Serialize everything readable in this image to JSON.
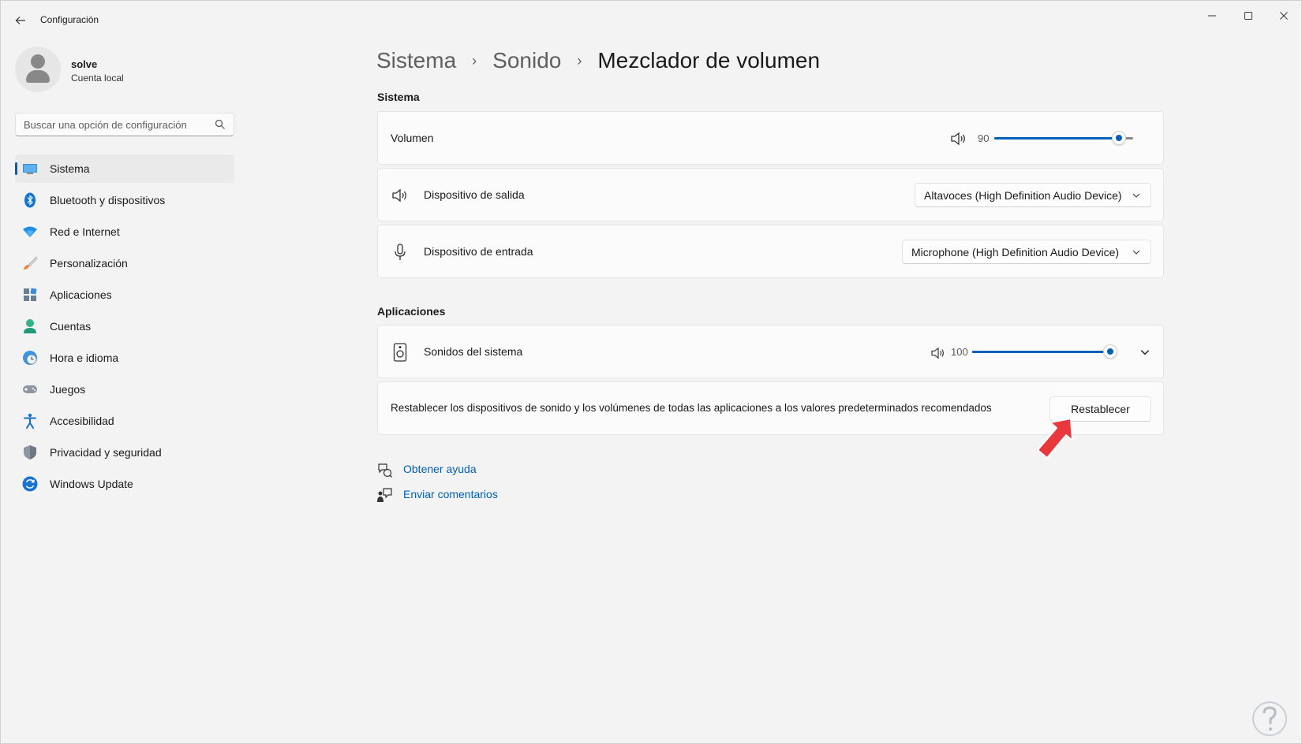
{
  "window": {
    "title": "Configuración",
    "controls": {
      "minimize": "minimize-icon",
      "maximize": "maximize-icon",
      "close": "close-icon"
    }
  },
  "profile": {
    "name": "solve",
    "account_type": "Cuenta local"
  },
  "search": {
    "placeholder": "Buscar una opción de configuración"
  },
  "sidebar": {
    "items": [
      {
        "label": "Sistema",
        "icon": "system-icon",
        "active": true
      },
      {
        "label": "Bluetooth y dispositivos",
        "icon": "bluetooth-icon"
      },
      {
        "label": "Red e Internet",
        "icon": "wifi-icon"
      },
      {
        "label": "Personalización",
        "icon": "brush-icon"
      },
      {
        "label": "Aplicaciones",
        "icon": "apps-icon"
      },
      {
        "label": "Cuentas",
        "icon": "accounts-icon"
      },
      {
        "label": "Hora e idioma",
        "icon": "time-language-icon"
      },
      {
        "label": "Juegos",
        "icon": "gamepad-icon"
      },
      {
        "label": "Accesibilidad",
        "icon": "accessibility-icon"
      },
      {
        "label": "Privacidad y seguridad",
        "icon": "shield-icon"
      },
      {
        "label": "Windows Update",
        "icon": "update-icon"
      }
    ]
  },
  "breadcrumb": {
    "items": [
      "Sistema",
      "Sonido",
      "Mezclador de volumen"
    ]
  },
  "system_section": {
    "title": "Sistema",
    "volume": {
      "label": "Volumen",
      "value": "90",
      "level_percent": 90
    },
    "output": {
      "label": "Dispositivo de salida",
      "selected": "Altavoces (High Definition Audio Device)"
    },
    "input": {
      "label": "Dispositivo de entrada",
      "selected": "Microphone (High Definition Audio Device)"
    }
  },
  "apps_section": {
    "title": "Aplicaciones",
    "system_sounds": {
      "label": "Sonidos del sistema",
      "value": "100",
      "level_percent": 100
    },
    "reset": {
      "text": "Restablecer los dispositivos de sonido y los volúmenes de todas las aplicaciones a los valores predeterminados recomendados",
      "button": "Restablecer"
    }
  },
  "links": {
    "help": "Obtener ayuda",
    "feedback": "Enviar comentarios"
  },
  "colors": {
    "accent": "#005fb8",
    "background": "#f3f3f3",
    "card": "#fbfbfb",
    "pointer": "#e8383d"
  }
}
